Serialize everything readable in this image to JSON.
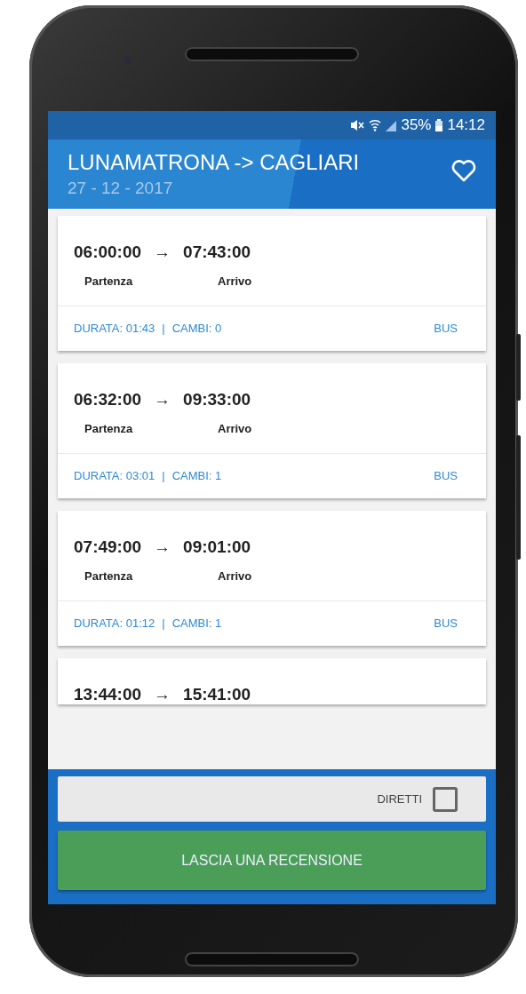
{
  "status_bar": {
    "battery": "35%",
    "time": "14:12"
  },
  "header": {
    "title": "LUNAMATRONA -> CAGLIARI",
    "date": "27 - 12 - 2017"
  },
  "trips": [
    {
      "departure": "06:00:00",
      "arrow": "→",
      "arrival": "07:43:00",
      "departure_label": "Partenza",
      "arrival_label": "Arrivo",
      "duration": "DURATA: 01:43",
      "separator": "|",
      "changes": "CAMBI: 0",
      "mode": "BUS"
    },
    {
      "departure": "06:32:00",
      "arrow": "→",
      "arrival": "09:33:00",
      "departure_label": "Partenza",
      "arrival_label": "Arrivo",
      "duration": "DURATA: 03:01",
      "separator": "|",
      "changes": "CAMBI: 1",
      "mode": "BUS"
    },
    {
      "departure": "07:49:00",
      "arrow": "→",
      "arrival": "09:01:00",
      "departure_label": "Partenza",
      "arrival_label": "Arrivo",
      "duration": "DURATA: 01:12",
      "separator": "|",
      "changes": "CAMBI: 1",
      "mode": "BUS"
    },
    {
      "departure": "13:44:00",
      "arrow": "→",
      "arrival": "15:41:00"
    }
  ],
  "filter": {
    "label": "DIRETTI",
    "checked": false
  },
  "review_button": "LASCIA UNA RECENSIONE"
}
